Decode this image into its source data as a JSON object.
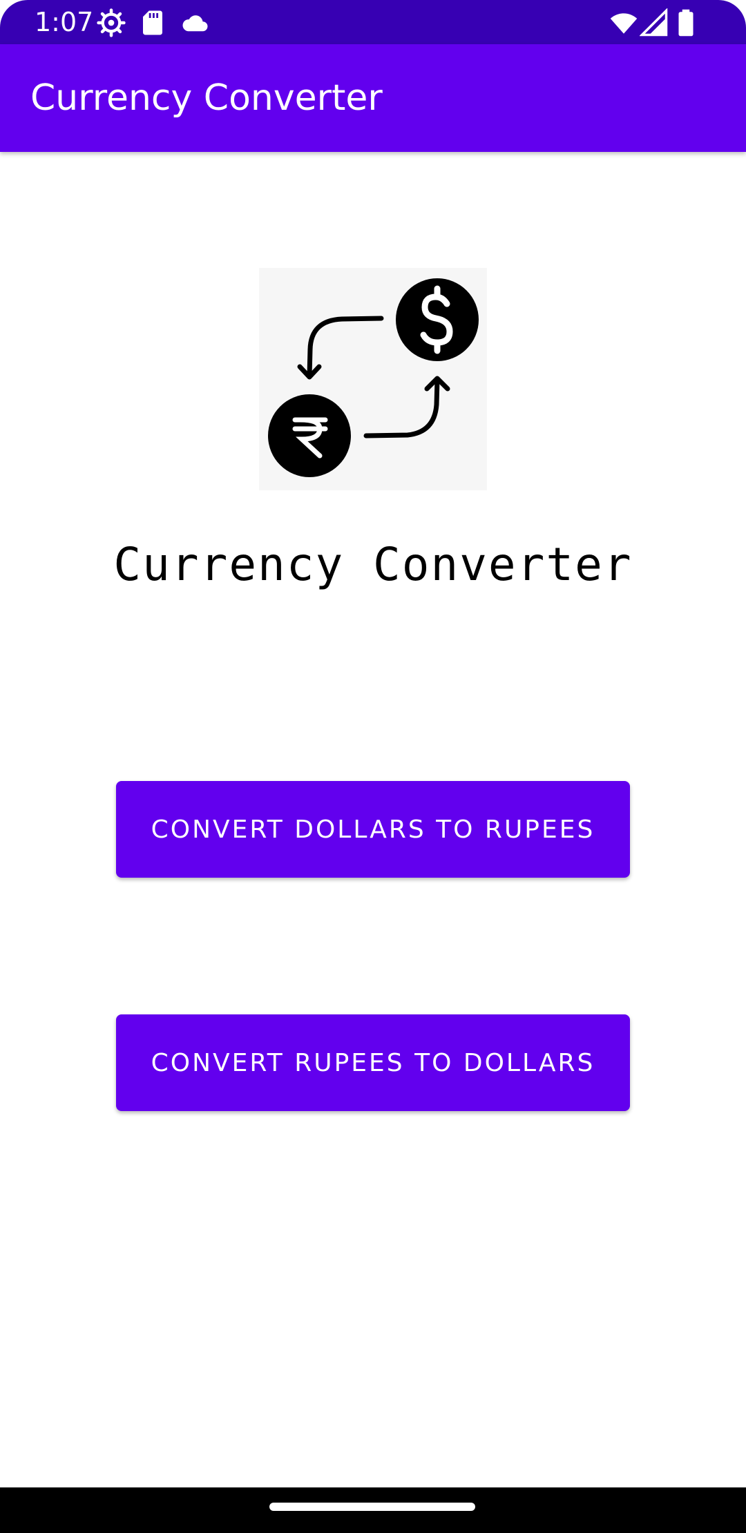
{
  "status_bar": {
    "time": "1:07",
    "icons": [
      "settings-gear-icon",
      "sd-card-icon",
      "cloud-icon",
      "wifi-icon",
      "cell-signal-icon",
      "battery-icon"
    ]
  },
  "app_bar": {
    "title": "Currency Converter"
  },
  "logo": {
    "icon": "currency-exchange-icon"
  },
  "main": {
    "title": "Currency Converter",
    "buttons": [
      {
        "label": "CONVERT DOLLARS TO RUPEES"
      },
      {
        "label": "CONVERT RUPEES TO DOLLARS"
      }
    ]
  },
  "colors": {
    "status_bar": "#3700b3",
    "primary": "#6200ee",
    "background": "#ffffff",
    "nav_bar": "#000000"
  }
}
